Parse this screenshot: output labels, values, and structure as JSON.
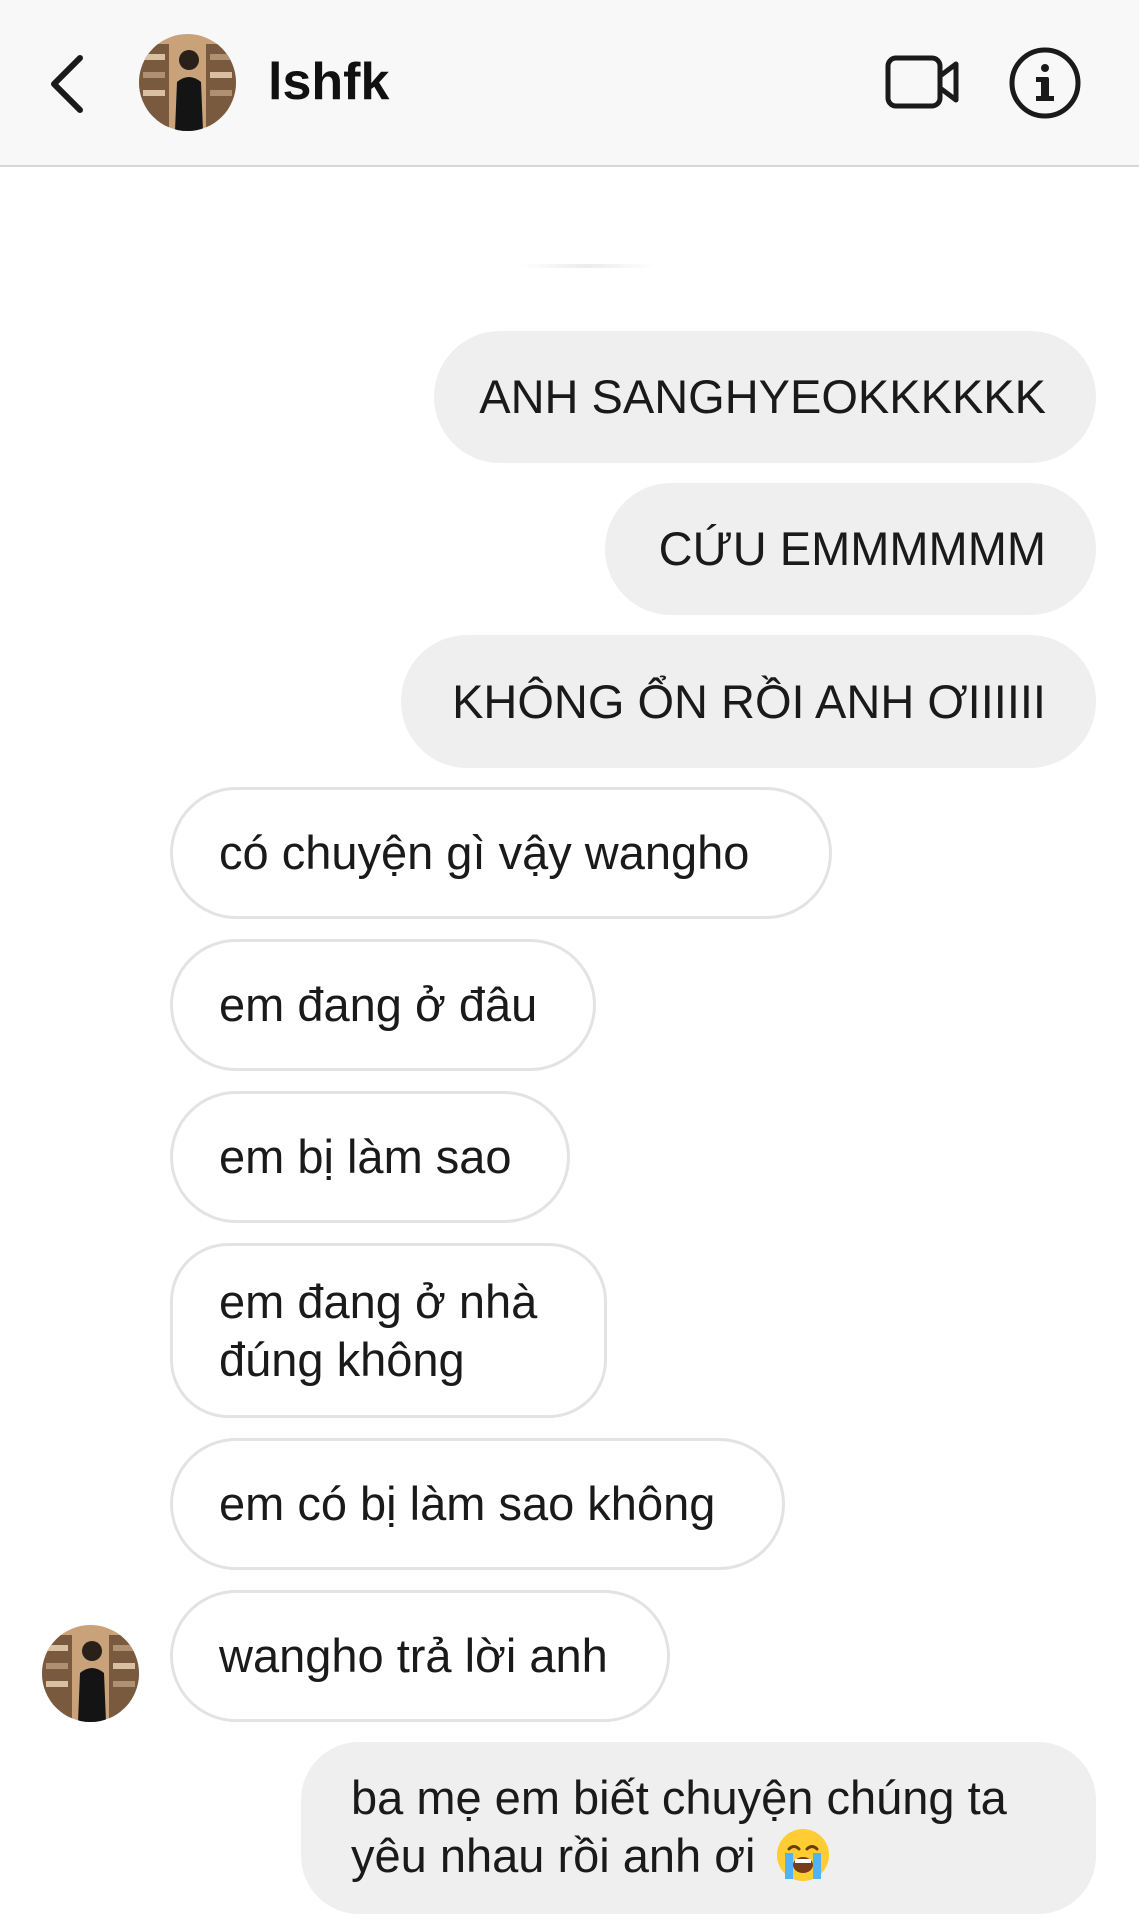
{
  "header": {
    "username": "lshfk",
    "back_icon": "chevron-left-icon",
    "video_icon": "video-call-icon",
    "info_icon": "info-icon"
  },
  "colors": {
    "outgoing_bubble": "#efefef",
    "incoming_border": "#e3e3e3",
    "header_bg": "#f8f8f8",
    "text": "#1a1a1a"
  },
  "messages": [
    {
      "from": "me",
      "text": "ANH SANGHYEOKKKKKK"
    },
    {
      "from": "me",
      "text": "CỨU EMMMMMM"
    },
    {
      "from": "me",
      "text": "KHÔNG ỔN RỒI ANH ƠIIIIII"
    },
    {
      "from": "them",
      "text": "có chuyện gì vậy wangho"
    },
    {
      "from": "them",
      "text": "em đang ở đâu"
    },
    {
      "from": "them",
      "text": "em bị làm sao"
    },
    {
      "from": "them",
      "text": "em đang ở nhà đúng không"
    },
    {
      "from": "them",
      "text": "em có bị làm sao không"
    },
    {
      "from": "them",
      "text": "wangho trả lời anh"
    },
    {
      "from": "me",
      "text": "ba mẹ em biết chuyện chúng ta yêu nhau rồi anh ơi",
      "emoji": "loudly-crying-face-icon"
    }
  ]
}
